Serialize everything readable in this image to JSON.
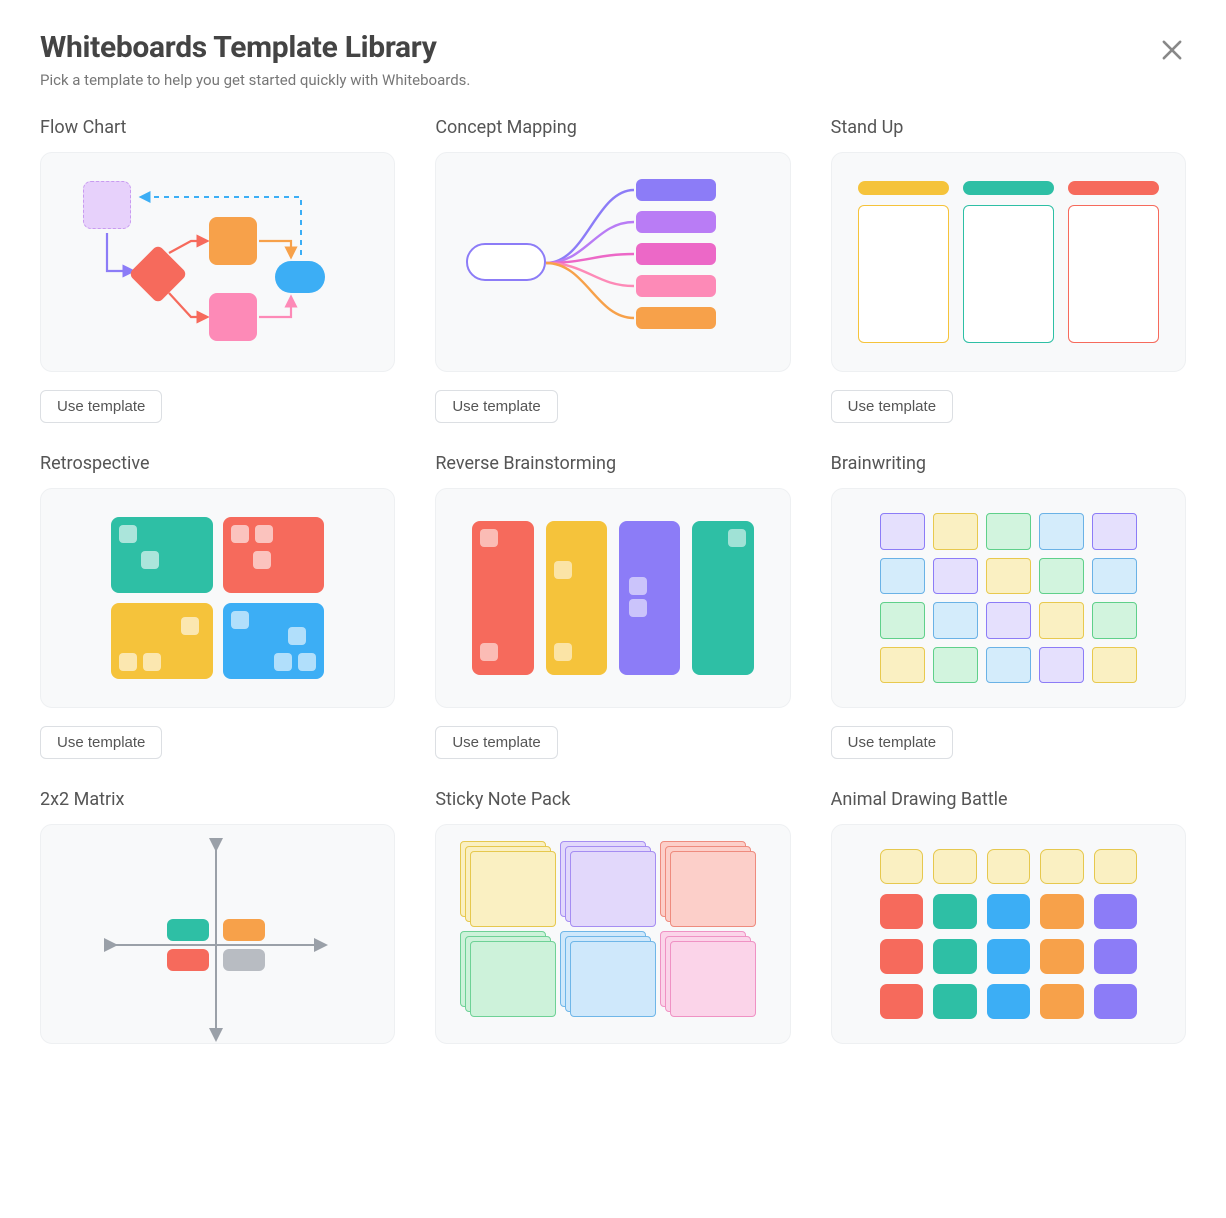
{
  "header": {
    "title": "Whiteboards Template Library",
    "subtitle": "Pick a template to help you get started quickly with Whiteboards."
  },
  "button_label": "Use template",
  "templates": [
    {
      "name": "Flow Chart"
    },
    {
      "name": "Concept Mapping"
    },
    {
      "name": "Stand Up"
    },
    {
      "name": "Retrospective"
    },
    {
      "name": "Reverse Brainstorming"
    },
    {
      "name": "Brainwriting"
    },
    {
      "name": "2x2 Matrix"
    },
    {
      "name": "Sticky Note Pack"
    },
    {
      "name": "Animal Drawing Battle"
    }
  ]
}
